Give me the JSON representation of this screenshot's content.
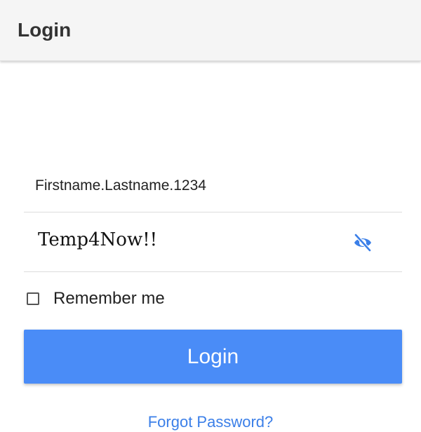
{
  "header": {
    "title": "Login"
  },
  "form": {
    "username": {
      "value": "Firstname.Lastname.1234",
      "placeholder": ""
    },
    "password": {
      "value": "Temp4Now!!",
      "placeholder": "",
      "visibility_icon": "eye-off-icon"
    },
    "remember_me": {
      "label": "Remember me",
      "checked": false
    },
    "submit_label": "Login",
    "forgot_password_label": "Forgot Password?"
  },
  "colors": {
    "accent": "#4a8cf7",
    "link": "#3b7fe8",
    "app_bar": "#f5f5f5"
  }
}
